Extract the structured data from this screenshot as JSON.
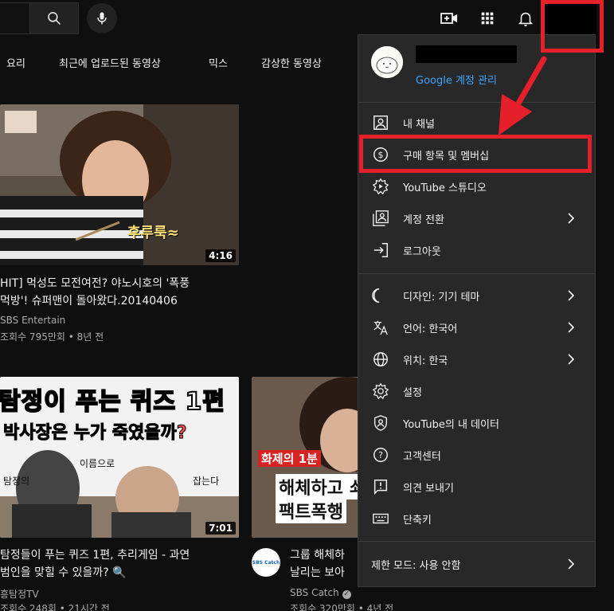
{
  "chips": [
    "요리",
    "최근에 업로드된 동영상",
    "믹스",
    "감상한 동영상"
  ],
  "videos": [
    {
      "title_line1": "HIT] 먹성도 모전여전? 야노시호의 '폭풍",
      "title_line2": "먹방'! 슈퍼맨이 돌아왔다.20140406",
      "channel": "SBS Entertain",
      "stats": "조회수 795만회 • 8년 전",
      "duration": "4:16",
      "thumb_caption": "후루룩≈"
    },
    {
      "title_line1": "탐정들이 푸는 퀴즈 1편, 추리게임 - 과연",
      "title_line2": "범인을 맞힐 수 있을까? 🔍",
      "channel": "흥탐정TV",
      "stats": "조회수 248회 • 21시간 전",
      "duration": "7:01",
      "thumb_line1": "탐정이 푸는 퀴즈 1편",
      "thumb_line2_a": "박사장은 ",
      "thumb_line2_b": "누가 죽였을까?",
      "thumb_small_a": "이름으로",
      "thumb_small_b": "탐정의",
      "thumb_small_c": "잡는다"
    },
    {
      "title_line1": "그룹 해체하",
      "title_line2": "날리는 보아",
      "channel": "SBS Catch",
      "stats": "조회수 320만회 • 4년 전",
      "channel_avatar_text": "SBS Catch",
      "thumb_tag": "화제의 1분",
      "thumb_line1": "해체하고 쇠",
      "thumb_line2": "팩트폭행"
    }
  ],
  "menu": {
    "manage_account": "Google 계정 관리",
    "items": [
      {
        "label": "내 채널",
        "icon": "person-box-icon",
        "chevron": false
      },
      {
        "label": "구매 항목 및 멤버십",
        "icon": "dollar-circle-icon",
        "chevron": false
      },
      {
        "label": "YouTube 스튜디오",
        "icon": "studio-gear-icon",
        "chevron": false
      },
      {
        "label": "계정 전환",
        "icon": "switch-account-icon",
        "chevron": true
      },
      {
        "label": "로그아웃",
        "icon": "sign-out-icon",
        "chevron": false
      },
      {
        "label": "디자인: 기기 테마",
        "icon": "moon-icon",
        "chevron": true
      },
      {
        "label": "언어: 한국어",
        "icon": "translate-icon",
        "chevron": true
      },
      {
        "label": "위치: 한국",
        "icon": "globe-icon",
        "chevron": true
      },
      {
        "label": "설정",
        "icon": "gear-icon",
        "chevron": false
      },
      {
        "label": "YouTube의 내 데이터",
        "icon": "shield-person-icon",
        "chevron": false
      },
      {
        "label": "고객센터",
        "icon": "help-icon",
        "chevron": false
      },
      {
        "label": "의견 보내기",
        "icon": "feedback-icon",
        "chevron": false
      },
      {
        "label": "단축키",
        "icon": "keyboard-icon",
        "chevron": false
      }
    ],
    "restricted_mode": "제한 모드: 사용 안함"
  },
  "colors": {
    "background": "#0f0f0f",
    "menu_background": "#282828",
    "link_blue": "#3ea6ff",
    "annotation_red": "#e5202a"
  }
}
